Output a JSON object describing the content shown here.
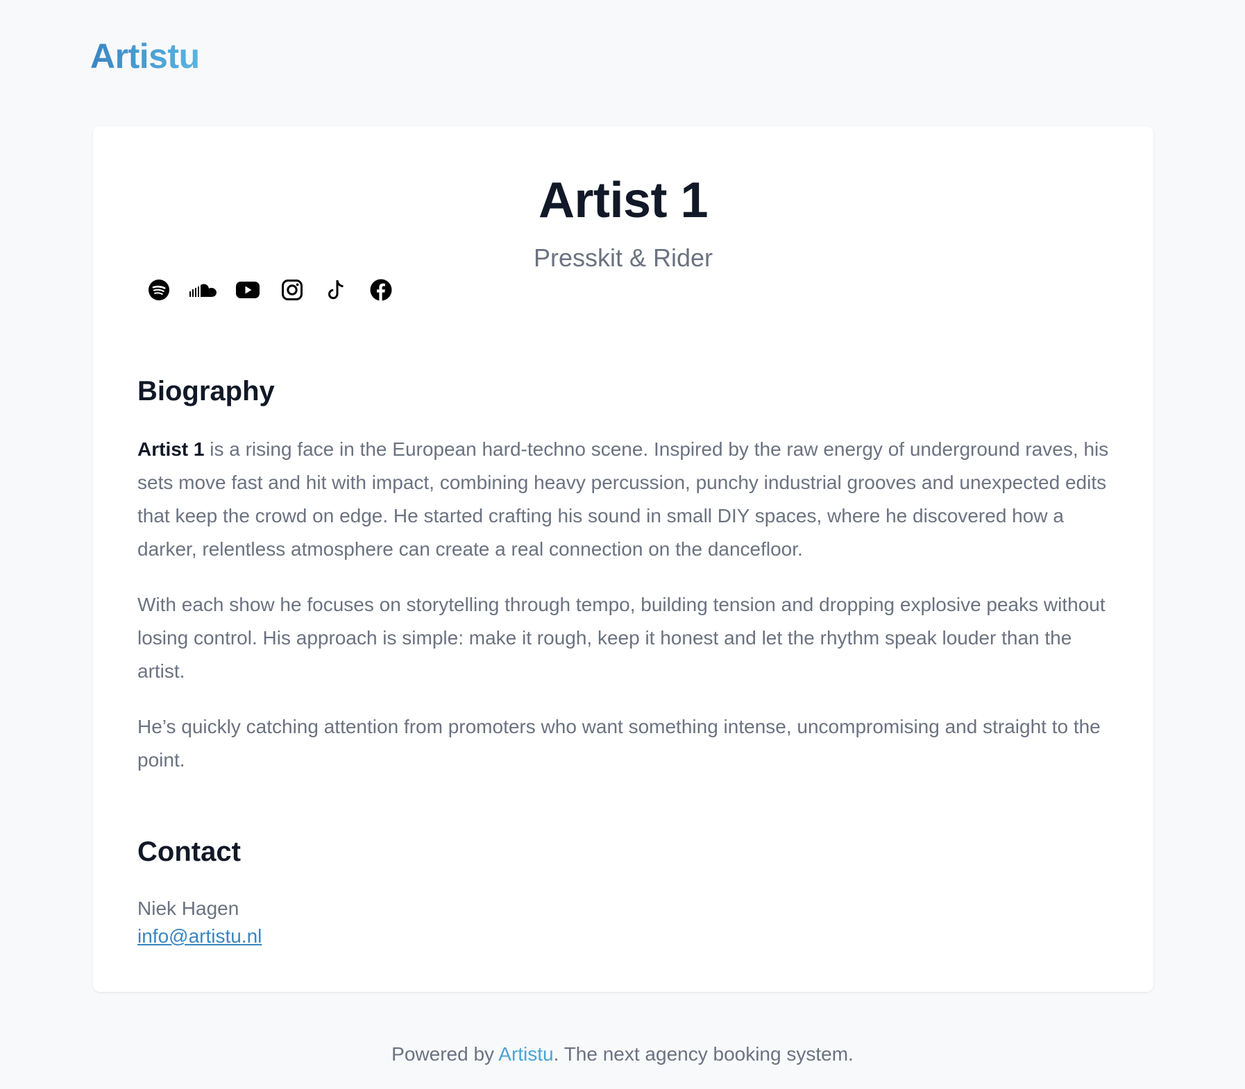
{
  "header": {
    "logo": "Artistu"
  },
  "artist": {
    "name": "Artist 1",
    "subtitle": "Presskit & Rider"
  },
  "socials": [
    {
      "name": "spotify-icon"
    },
    {
      "name": "soundcloud-icon"
    },
    {
      "name": "youtube-icon"
    },
    {
      "name": "instagram-icon"
    },
    {
      "name": "tiktok-icon"
    },
    {
      "name": "facebook-icon"
    }
  ],
  "biography": {
    "heading": "Biography",
    "p1_bold": "Artist 1",
    "p1_rest": " is a rising face in the European hard-techno scene. Inspired by the raw energy of underground raves, his sets move fast and hit with impact, combining heavy percussion, punchy industrial grooves and unexpected edits that keep the crowd on edge. He started crafting his sound in small DIY spaces, where he discovered how a darker, relentless atmosphere can create a real connection on the dancefloor.",
    "p2": "With each show he focuses on storytelling through tempo, building tension and dropping explosive peaks without losing control. His approach is simple: make it rough, keep it honest and let the rhythm speak louder than the artist.",
    "p3": "He’s quickly catching attention from promoters who want something intense, uncompromising and straight to the point."
  },
  "contact": {
    "heading": "Contact",
    "name": "Niek Hagen",
    "email": "info@artistu.nl"
  },
  "footer": {
    "prefix": "Powered by ",
    "brand": "Artistu",
    "suffix": ". The next agency booking system."
  },
  "colors": {
    "background": "#f8f9fb",
    "card": "#ffffff",
    "text_dark": "#111827",
    "text_muted": "#6b7280",
    "link": "#3a86c2",
    "brand": "#4aa3d6"
  }
}
